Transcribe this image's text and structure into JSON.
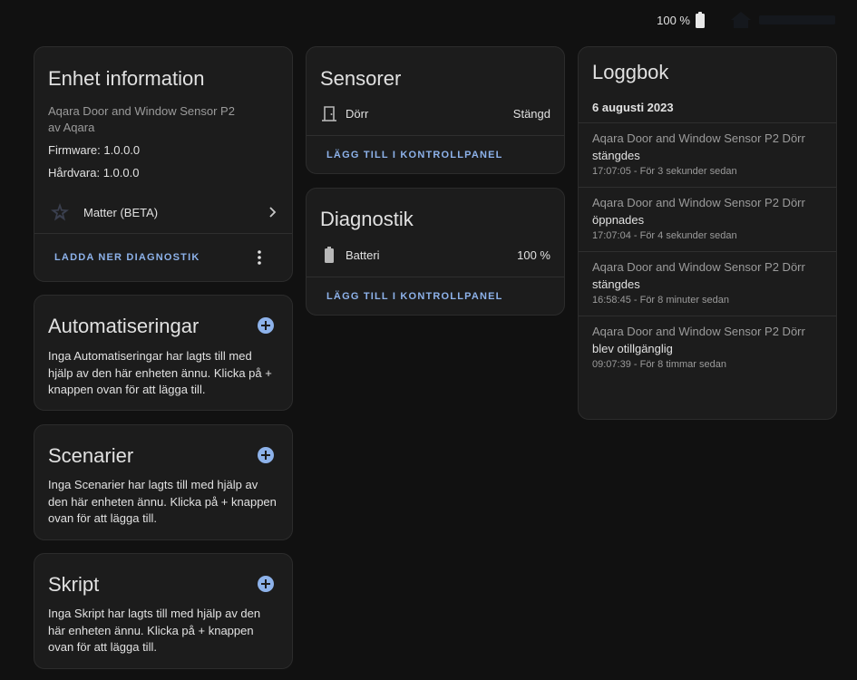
{
  "topbar": {
    "battery_text": "100 %"
  },
  "device_info": {
    "title": "Enhet information",
    "model": "Aqara Door and Window Sensor P2",
    "manufacturer": "av Aqara",
    "firmware": "Firmware: 1.0.0.0",
    "hardware": "Hårdvara: 1.0.0.0",
    "integration": "Matter (BETA)",
    "download_label": "LADDA NER DIAGNOSTIK"
  },
  "automations": {
    "title": "Automatiseringar",
    "description": "Inga Automatiseringar har lagts till med hjälp av den här enheten ännu. Klicka på + knappen ovan för att lägga till."
  },
  "scenes": {
    "title": "Scenarier",
    "description": "Inga Scenarier har lagts till med hjälp av den här enheten ännu. Klicka på + knappen ovan för att lägga till."
  },
  "scripts": {
    "title": "Skript",
    "description": "Inga Skript har lagts till med hjälp av den här enheten ännu. Klicka på + knappen ovan för att lägga till."
  },
  "sensors": {
    "title": "Sensorer",
    "entity_label": "Dörr",
    "entity_value": "Stängd",
    "add_label": "LÄGG TILL I KONTROLLPANEL",
    "entity_icon": "door-icon"
  },
  "diagnostics": {
    "title": "Diagnostik",
    "entity_label": "Batteri",
    "entity_value": "100 %",
    "add_label": "LÄGG TILL I KONTROLLPANEL",
    "entity_icon": "battery-icon"
  },
  "logbook": {
    "title": "Loggbok",
    "date": "6 augusti 2023",
    "entries": [
      {
        "source": "Aqara Door and Window Sensor P2 Dörr",
        "state": "stängdes",
        "time": "17:07:05 - För 3 sekunder sedan"
      },
      {
        "source": "Aqara Door and Window Sensor P2 Dörr",
        "state": "öppnades",
        "time": "17:07:04 - För 4 sekunder sedan"
      },
      {
        "source": "Aqara Door and Window Sensor P2 Dörr",
        "state": "stängdes",
        "time": "16:58:45 - För 8 minuter sedan"
      },
      {
        "source": "Aqara Door and Window Sensor P2 Dörr",
        "state": "blev otillgänglig",
        "time": "09:07:39 - För 8 timmar sedan"
      }
    ]
  },
  "colors": {
    "background": "#111111",
    "card": "#1c1c1c",
    "accent": "#8db2ea",
    "text": "#e1e1e1",
    "muted": "#9b9b9b"
  }
}
